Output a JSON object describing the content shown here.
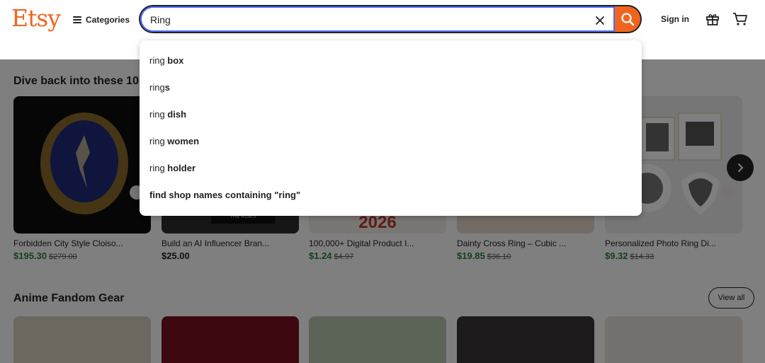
{
  "header": {
    "logo": "Etsy",
    "categories_label": "Categories",
    "search_value": "Ring",
    "signin_label": "Sign in"
  },
  "sections": {
    "recent_title": "Dive back into these 10",
    "anime_title": "Anime Fandom Gear",
    "view_all_label": "View all"
  },
  "recent_items": [
    {
      "name": "Forbidden City Style Cloiso...",
      "price": "$195.30",
      "orig": "$279.00"
    },
    {
      "name": "Build an AI Influencer Bran...",
      "price": "$25.00",
      "orig": ""
    },
    {
      "name": "100,000+ Digital Product I...",
      "price": "$1.24",
      "orig": "$4.97"
    },
    {
      "name": "Dainty Cross Ring – Cubic ...",
      "price": "$19.85",
      "orig": "$36.10"
    },
    {
      "name": "Personalized Photo Ring Di...",
      "price": "$9.32",
      "orig": "$14.33"
    }
  ],
  "image_labels": {
    "rises": "THE RISES",
    "year": "2026"
  },
  "suggestions": [
    {
      "prefix": "ring ",
      "bold": "box"
    },
    {
      "prefix": "ring",
      "bold": "s"
    },
    {
      "prefix": "ring ",
      "bold": "dish"
    },
    {
      "prefix": "ring ",
      "bold": "women"
    },
    {
      "prefix": "ring ",
      "bold": "holder"
    },
    {
      "prefix": "",
      "bold": "find shop names containing \"ring\""
    }
  ],
  "colors": {
    "brand": "#f1641e",
    "sale_price": "#258635",
    "focus_ring": "#4d6bfe"
  },
  "icons": [
    "menu-icon",
    "clear-icon",
    "search-icon",
    "gift-icon",
    "cart-icon",
    "chevron-right-icon"
  ]
}
